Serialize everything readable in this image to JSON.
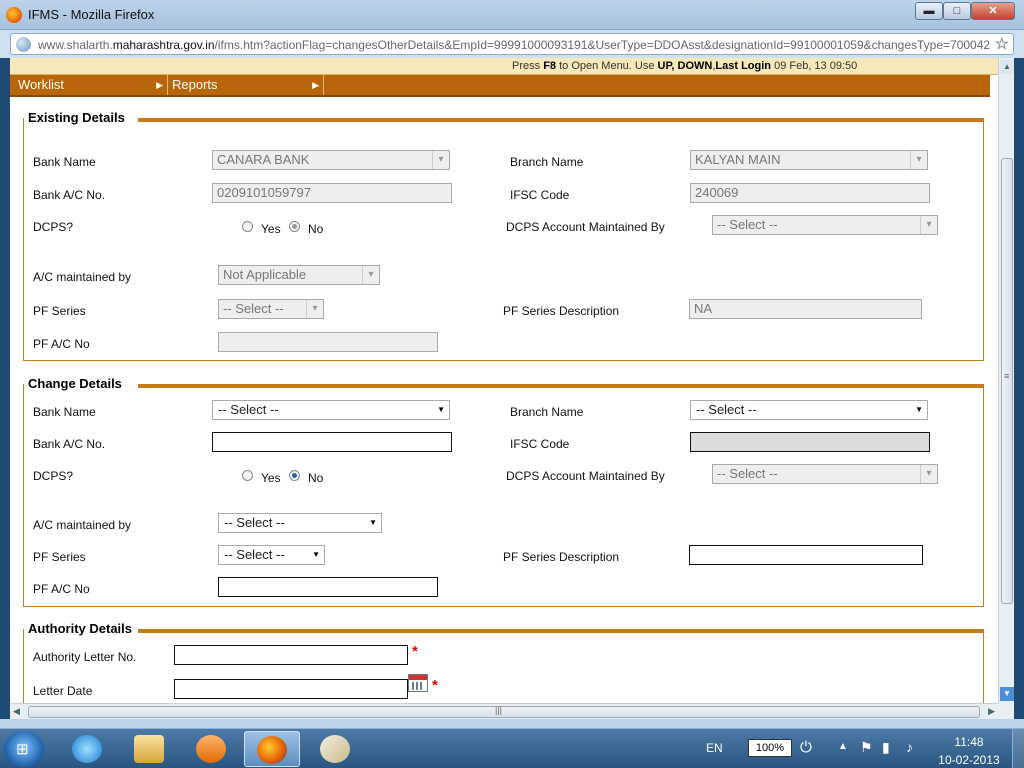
{
  "window": {
    "title": "IFMS - Mozilla Firefox",
    "url_prefix": "www.shalarth.",
    "url_domain": "maharashtra.gov.in",
    "url_rest": "/ifms.htm?actionFlag=changesOtherDetails&EmpId=99991000093191&UserType=DDOAsst&designationId=99100001059&changesType=700042",
    "min_glyph": "▬",
    "max_glyph": "□",
    "close_glyph": "✕"
  },
  "banner": {
    "press": "Press ",
    "key": "F8",
    "to_open": " to Open Menu. Use ",
    "keys": "UP, DOWN",
    "comma": ",",
    "last_login_label": "Last Login",
    "last_login_value": " 09 Feb, 13 09:50"
  },
  "menu": {
    "items": [
      {
        "label": "Worklist"
      },
      {
        "label": "Reports"
      }
    ]
  },
  "existing": {
    "legend": "Existing Details",
    "bank_name_label": "Bank Name",
    "bank_name_value": "CANARA BANK",
    "branch_name_label": "Branch Name",
    "branch_name_value": "KALYAN MAIN",
    "bank_ac_label": "Bank A/C No.",
    "bank_ac_value": "0209101059797",
    "ifsc_label": "IFSC Code",
    "ifsc_value": "240069",
    "dcps_label": "DCPS?",
    "yes_label": "Yes",
    "no_label": "No",
    "dcps_selected": "No",
    "dcps_maintained_label": "DCPS Account Maintained By",
    "dcps_maintained_value": "-- Select --",
    "ac_maintained_label": "A/C maintained by",
    "ac_maintained_value": "Not Applicable",
    "pf_series_label": "PF Series",
    "pf_series_value": "-- Select --",
    "pf_series_desc_label": "PF Series Description",
    "pf_series_desc_value": "NA",
    "pf_ac_label": "PF A/C No",
    "pf_ac_value": ""
  },
  "change": {
    "legend": "Change Details",
    "bank_name_label": "Bank Name",
    "bank_name_value": "-- Select --",
    "branch_name_label": "Branch Name",
    "branch_name_value": "-- Select --",
    "bank_ac_label": "Bank A/C No.",
    "bank_ac_value": "",
    "ifsc_label": "IFSC Code",
    "ifsc_value": "",
    "dcps_label": "DCPS?",
    "yes_label": "Yes",
    "no_label": "No",
    "dcps_selected": "No",
    "dcps_maintained_label": "DCPS Account Maintained By",
    "dcps_maintained_value": "-- Select --",
    "ac_maintained_label": "A/C maintained by",
    "ac_maintained_value": "-- Select --",
    "pf_series_label": "PF Series",
    "pf_series_value": "-- Select --",
    "pf_series_desc_label": "PF Series Description",
    "pf_series_desc_value": "",
    "pf_ac_label": "PF A/C No",
    "pf_ac_value": ""
  },
  "authority": {
    "legend": "Authority Details",
    "letter_no_label": "Authority Letter No.",
    "letter_no_value": "",
    "letter_date_label": "Letter Date",
    "letter_date_value": "",
    "required_mark": "*"
  },
  "taskbar": {
    "language": "EN",
    "battery": "100%",
    "time": "11:48",
    "date": "10-02-2013"
  },
  "icons": [
    "firefox-icon",
    "globe-icon",
    "bookmark-star-icon",
    "calendar-icon",
    "windows-start-icon",
    "ie-icon",
    "explorer-icon",
    "media-player-icon",
    "firefox-taskbar-icon",
    "paint-icon",
    "flag-icon",
    "volume-icon",
    "power-icon"
  ]
}
